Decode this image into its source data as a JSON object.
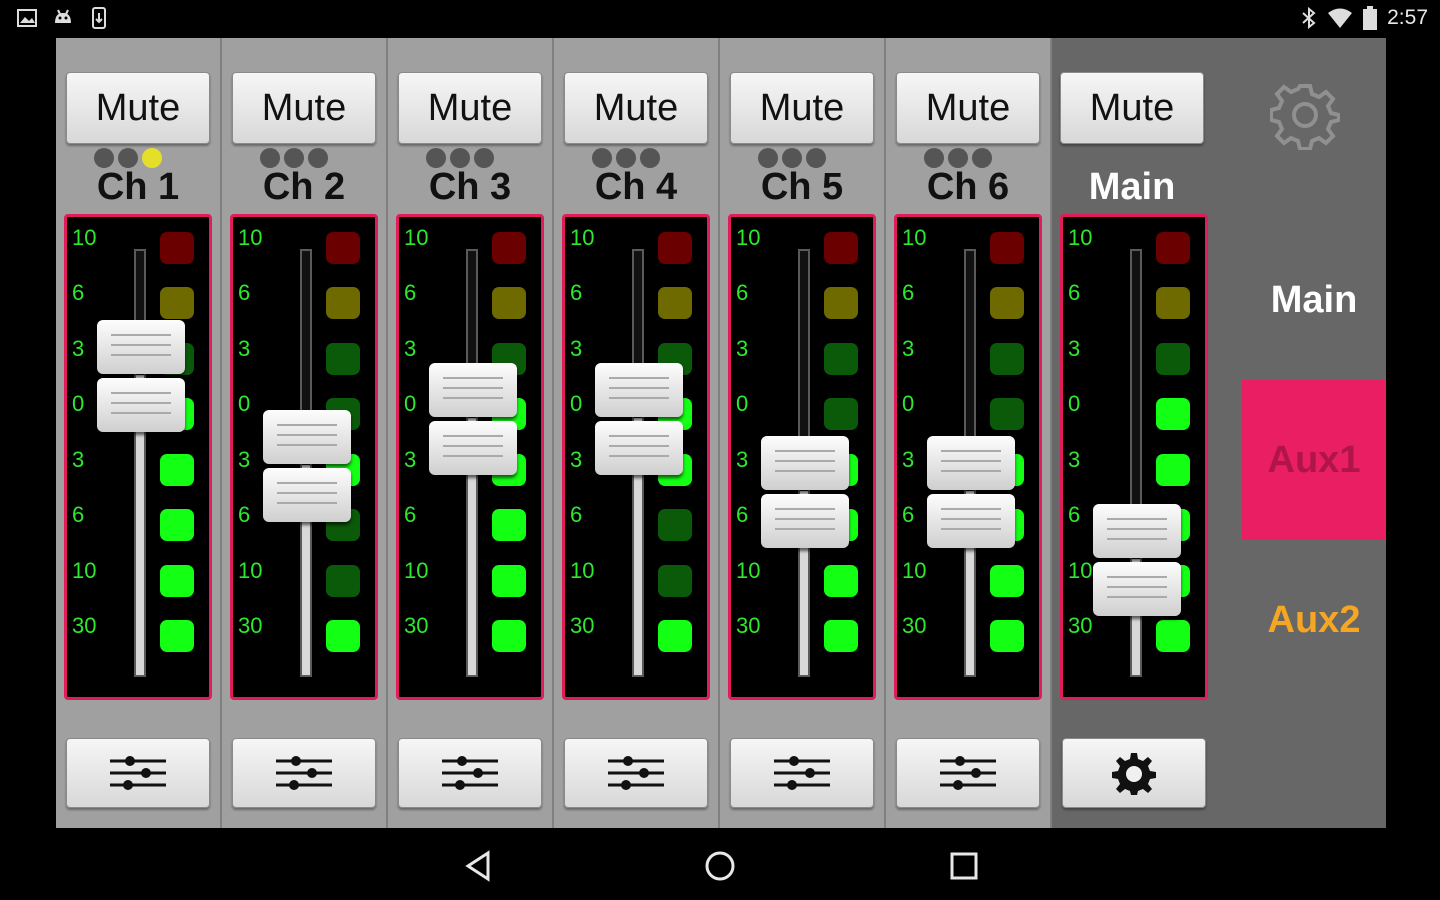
{
  "status": {
    "time": "2:57",
    "icons": [
      "image-icon",
      "android-icon",
      "phone-icon",
      "bluetooth-icon",
      "wifi-icon",
      "battery-icon"
    ]
  },
  "ticks": [
    "10",
    "6",
    "3",
    "0",
    "3",
    "6",
    "10",
    "30"
  ],
  "channels": [
    {
      "mute": "Mute",
      "label": "Ch 1",
      "fader": 0.7,
      "dots": [
        false,
        false,
        true
      ],
      "leds": [
        0,
        0,
        0,
        1,
        1,
        1,
        1,
        1
      ]
    },
    {
      "mute": "Mute",
      "label": "Ch 2",
      "fader": 0.49,
      "dots": [
        false,
        false,
        false
      ],
      "leds": [
        0,
        0,
        0,
        0,
        1,
        0,
        0,
        1
      ]
    },
    {
      "mute": "Mute",
      "label": "Ch 3",
      "fader": 0.6,
      "dots": [
        false,
        false,
        false
      ],
      "leds": [
        0,
        0,
        0,
        1,
        1,
        1,
        1,
        1
      ]
    },
    {
      "mute": "Mute",
      "label": "Ch 4",
      "fader": 0.6,
      "dots": [
        false,
        false,
        false
      ],
      "leds": [
        0,
        0,
        0,
        1,
        1,
        0,
        0,
        1
      ]
    },
    {
      "mute": "Mute",
      "label": "Ch 5",
      "fader": 0.43,
      "dots": [
        false,
        false,
        false
      ],
      "leds": [
        0,
        0,
        0,
        0,
        1,
        1,
        1,
        1
      ]
    },
    {
      "mute": "Mute",
      "label": "Ch 6",
      "fader": 0.43,
      "dots": [
        false,
        false,
        false
      ],
      "leds": [
        0,
        0,
        0,
        0,
        1,
        1,
        1,
        1
      ]
    }
  ],
  "main": {
    "mute": "Mute",
    "label": "Main",
    "fader": 0.27,
    "leds": [
      0,
      0,
      0,
      1,
      1,
      1,
      1,
      1
    ]
  },
  "side": {
    "items": [
      {
        "label": "Main",
        "color": "#ffffff",
        "selected": false
      },
      {
        "label": "Aux1",
        "color": "#b0154a",
        "selected": true
      },
      {
        "label": "Aux2",
        "color": "#f5a623",
        "selected": false
      }
    ]
  },
  "colors": {
    "accent": "#e91e63",
    "led_red": "#6b0000",
    "led_yellow": "#6e6a00",
    "led_green_off": "#0a5a0a",
    "led_green_on": "#13ff13"
  }
}
